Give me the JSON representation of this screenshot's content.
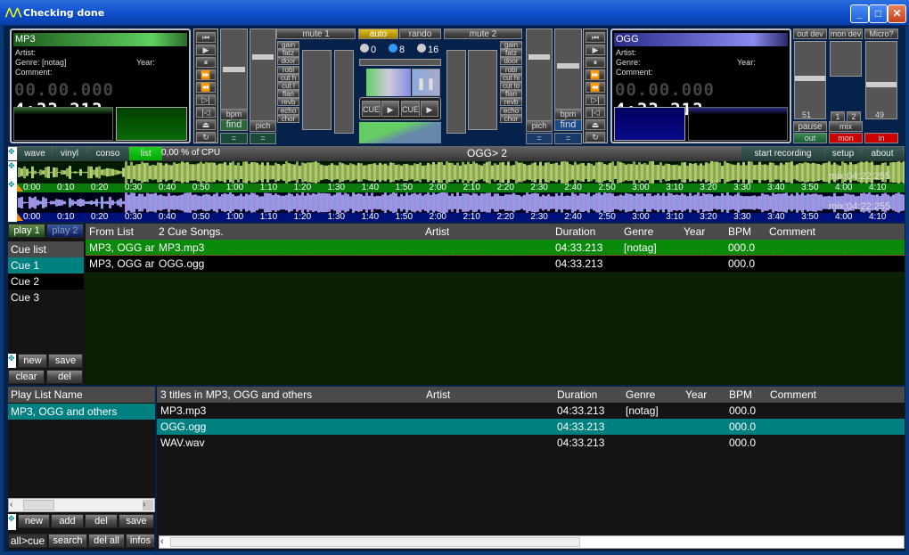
{
  "window": {
    "title": "Checking done",
    "min": "_",
    "max": "□",
    "close": "✕"
  },
  "deck1": {
    "title": "MP3",
    "artist_label": "Artist:",
    "genre_label": "Genre: [notag]",
    "year_label": "Year:",
    "comment_label": "Comment:",
    "time_dim": "00.00.000",
    "time_lit": "4:33.213",
    "bpm_label": "bpm",
    "pitch_label": "pich",
    "find": "find",
    "eq": "=",
    "color": "#3fa63f"
  },
  "deck2": {
    "title": "OGG",
    "artist_label": "Artist:",
    "genre_label": "Genre:",
    "year_label": "Year:",
    "comment_label": "Comment:",
    "time_dim": "00.00.000",
    "time_lit": "4:33.213",
    "bpm_label": "bpm",
    "pitch_label": "pich",
    "find": "find",
    "eq": "=",
    "color": "#5a5ad8"
  },
  "transport": [
    "⏮",
    "▶",
    "⏸",
    "⏩",
    "⏪",
    "▷|",
    "|◁",
    "⏏",
    "↻"
  ],
  "mixer1": {
    "mute": "mute 1",
    "effects": [
      "gain",
      "fatz",
      "door",
      "robi",
      "cut h",
      "cut l",
      "flan",
      "revb",
      "echo",
      "chor"
    ]
  },
  "mixer2": {
    "mute": "mute  2",
    "effects": [
      "gain",
      "fatz",
      "door",
      "robi",
      "cut hi",
      "cut lo",
      "flan",
      "revb",
      "echo",
      "chor"
    ]
  },
  "center": {
    "auto": "auto",
    "rando": "rando",
    "radios": [
      "0",
      "8",
      "16"
    ],
    "radio_selected": "8",
    "cue": "CUE",
    "play": "▶",
    "pause": "❚❚"
  },
  "output": {
    "out_dev": "out dev",
    "mon_dev": "mon dev",
    "mic": "Micro?fone",
    "out_value": "51",
    "in_value": "49",
    "pause": "pause",
    "mix": "mix",
    "mix1": "1",
    "mix2": "2",
    "out": "out",
    "mon": "mon",
    "in": "in"
  },
  "toolbar": {
    "tabs": [
      "wave",
      "vinyl",
      "conso",
      "list"
    ],
    "active": "list",
    "cpu": "0,00  % of CPU",
    "status": "OGG> 2",
    "start_recording": "start recording",
    "setup": "setup",
    "about": "about"
  },
  "timeline": {
    "labels": [
      "0:00",
      "0:10",
      "0:20",
      "0:30",
      "0:40",
      "0:50",
      "1:00",
      "1:10",
      "1:20",
      "1:30",
      "1:40",
      "1:50",
      "2:00",
      "2:10",
      "2:20",
      "2:30",
      "2:40",
      "2:50",
      "3:00",
      "3:10",
      "3:20",
      "3:30",
      "3:40",
      "3:50",
      "4:00",
      "4:10"
    ],
    "mix1": "mix:04:22:255",
    "mix2": "mix:04:22:255"
  },
  "cue_panel": {
    "play1": "play 1",
    "play2": "play 2",
    "header": "Cue list",
    "items": [
      "Cue 1",
      "Cue 2",
      "Cue 3"
    ],
    "selected": "Cue 1",
    "new": "new",
    "save": "save",
    "clear": "clear",
    "del": "del"
  },
  "cue_table": {
    "columns": [
      "From List",
      "2 Cue Songs.",
      "Artist",
      "Duration",
      "Genre",
      "Year",
      "BPM",
      "Comment"
    ],
    "rows": [
      [
        "MP3, OGG ar",
        "MP3.mp3",
        "",
        "04:33.213",
        "[notag]",
        "",
        "000.0",
        ""
      ],
      [
        "MP3, OGG ar",
        "OGG.ogg",
        "",
        "04:33.213",
        "",
        "",
        "000.0",
        ""
      ]
    ]
  },
  "playlists": {
    "header": "Play List Name",
    "items": [
      "MP3, OGG and others"
    ],
    "buttons1": [
      "new",
      "add",
      "del",
      "save"
    ],
    "buttons2": [
      "all>cue",
      "search",
      "del all",
      "infos"
    ]
  },
  "titles_table": {
    "columns": [
      "3 titles in MP3, OGG and others",
      "Artist",
      "Duration",
      "Genre",
      "Year",
      "BPM",
      "Comment"
    ],
    "rows": [
      [
        "MP3.mp3",
        "",
        "04:33.213",
        "[notag]",
        "",
        "000.0",
        ""
      ],
      [
        "OGG.ogg",
        "",
        "04:33.213",
        "",
        "",
        "000.0",
        ""
      ],
      [
        "WAV.wav",
        "",
        "04:33.213",
        "",
        "",
        "000.0",
        ""
      ]
    ],
    "selected": 1
  }
}
